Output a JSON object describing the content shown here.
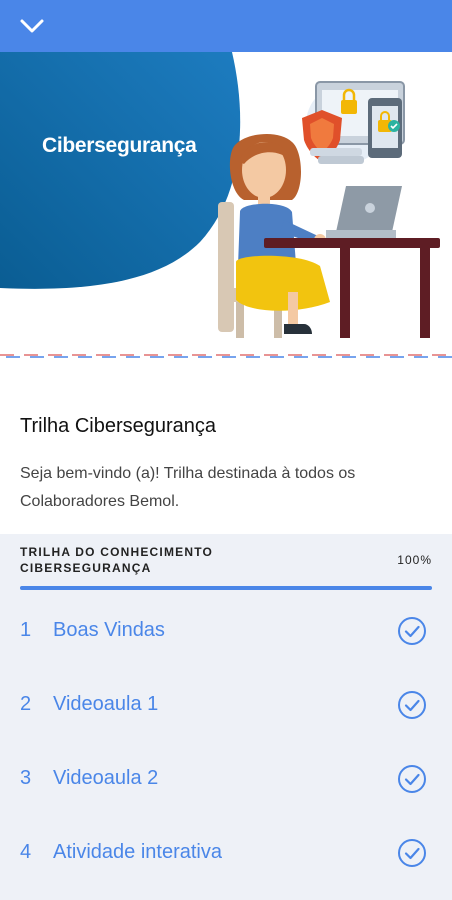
{
  "header": {
    "collapse_icon": "chevron-down-icon"
  },
  "banner": {
    "title": "Cibersegurança"
  },
  "course": {
    "title": "Trilha Cibersegurança",
    "description": "Seja bem-vindo (a)! Trilha destinada à todos os Colaboradores Bemol."
  },
  "track": {
    "label_line1": "TRILHA DO CONHECIMENTO",
    "label_line2": "CIBERSEGURANÇA",
    "progress_text": "100%",
    "progress_value": 1.0,
    "items": [
      {
        "number": "1",
        "label": "Boas Vindas",
        "status_icon": "check-circle-icon"
      },
      {
        "number": "2",
        "label": "Videoaula 1",
        "status_icon": "check-circle-icon"
      },
      {
        "number": "3",
        "label": "Videoaula 2",
        "status_icon": "check-circle-icon"
      },
      {
        "number": "4",
        "label": "Atividade interativa",
        "status_icon": "check-circle-icon"
      }
    ]
  },
  "colors": {
    "accent": "#4a86e8",
    "banner_blue": "#0b5f96",
    "panel_bg": "#eef1f7"
  }
}
